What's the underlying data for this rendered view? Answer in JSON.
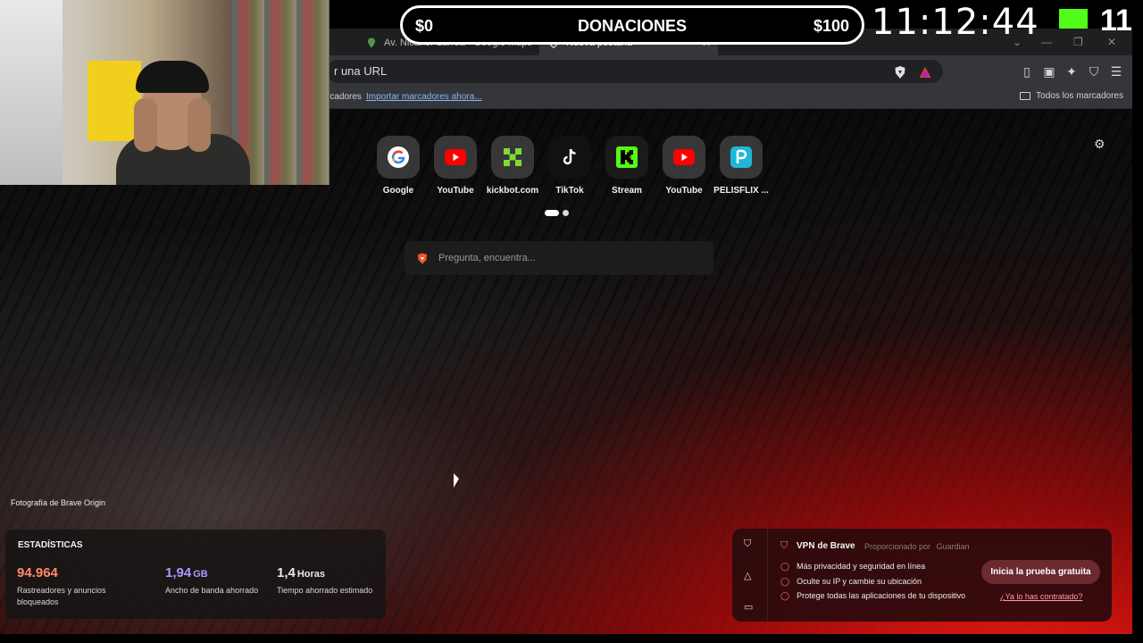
{
  "stream": {
    "donations": {
      "min": "$0",
      "title": "DONACIONES",
      "max": "$100"
    },
    "clock": "11:12:44",
    "viewers": "11"
  },
  "tabs": [
    {
      "label": "Av. Nicanor Larrea - Google Maps",
      "icon": "maps-pin-icon",
      "active": false
    },
    {
      "label": "Nueva pestaña",
      "icon": "brave-shield-icon",
      "active": true
    }
  ],
  "toolbar": {
    "url_text": "r una URL"
  },
  "bookmarks": {
    "text": "rcadores",
    "import_link": "Importar marcadores ahora...",
    "all_label": "Todos los marcadores"
  },
  "topsites": [
    {
      "label": "Google",
      "icon": "google-icon"
    },
    {
      "label": "YouTube",
      "icon": "youtube-icon"
    },
    {
      "label": "kickbot.com",
      "icon": "kickbot-icon"
    },
    {
      "label": "TikTok",
      "icon": "tiktok-icon"
    },
    {
      "label": "Stream",
      "icon": "kick-icon"
    },
    {
      "label": "YouTube",
      "icon": "youtube-icon"
    },
    {
      "label": "PELISFLIX ...",
      "icon": "pelisflix-icon"
    }
  ],
  "search": {
    "placeholder": "Pregunta, encuentra..."
  },
  "photo_credit": "Fotografía de Brave Origin",
  "stats": {
    "title": "ESTADÍSTICAS",
    "items": [
      {
        "value": "94.964",
        "unit": "",
        "label": "Rastreadores y anuncios bloqueados",
        "color": "#ff8a6a"
      },
      {
        "value": "1,94",
        "unit": "GB",
        "label": "Ancho de banda ahorrado",
        "color": "#a79bff"
      },
      {
        "value": "1,4",
        "unit": "Horas",
        "label": "Tiempo ahorrado estimado",
        "color": "#ffffff"
      }
    ]
  },
  "vpn": {
    "title": "VPN de Brave",
    "provided_by": "Proporcionado por",
    "provider": "Guardian",
    "features": [
      "Más privacidad y seguridad en línea",
      "Oculte su IP y cambie su ubicación",
      "Protege todas las aplicaciones de tu dispositivo"
    ],
    "cta": "Inicia la prueba gratuita",
    "link": "¿Ya lo has contratado?"
  }
}
